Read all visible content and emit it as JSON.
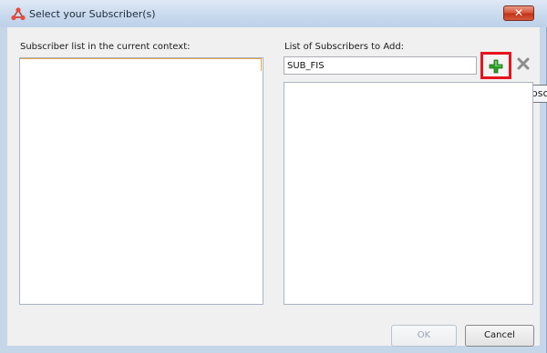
{
  "window": {
    "title": "Select your Subscriber(s)",
    "close_label": "✕"
  },
  "left_panel": {
    "label": "Subscriber list in the current context:"
  },
  "right_panel": {
    "label": "List of Subscribers to Add:",
    "input_value": "SUB_FIS",
    "add_tooltip": "Add Subsc"
  },
  "footer": {
    "ok_label": "OK",
    "cancel_label": "Cancel"
  },
  "icons": {
    "app": "network-nodes-icon",
    "add": "green-plus-icon",
    "remove": "gray-x-icon"
  },
  "colors": {
    "highlight": "#e8141e",
    "add_green": "#2e9e28"
  }
}
